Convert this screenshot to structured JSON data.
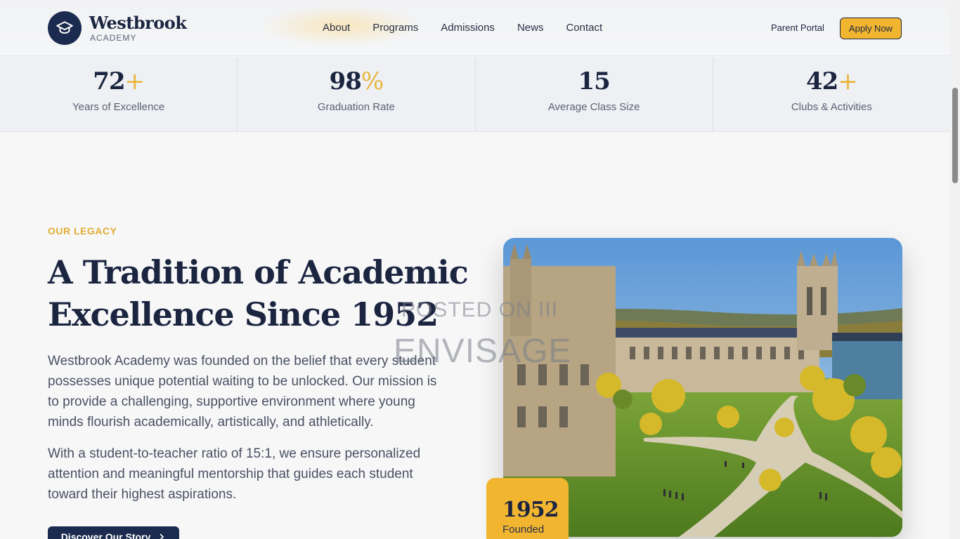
{
  "brand": {
    "name": "Westbrook",
    "sub": "ACADEMY"
  },
  "nav": {
    "items": [
      "About",
      "Programs",
      "Admissions",
      "News",
      "Contact"
    ],
    "parent_portal": "Parent Portal",
    "apply": "Apply Now"
  },
  "stats": [
    {
      "value": "72",
      "suffix": "+",
      "label": "Years of Excellence"
    },
    {
      "value": "98",
      "suffix": "%",
      "label": "Graduation Rate"
    },
    {
      "value": "15",
      "suffix": "",
      "label": "Average Class Size"
    },
    {
      "value": "42",
      "suffix": "+",
      "label": "Clubs & Activities"
    }
  ],
  "legacy": {
    "eyebrow": "OUR LEGACY",
    "title": "A Tradition of Academic Excellence Since 1952",
    "para1": "Westbrook Academy was founded on the belief that every student possesses unique potential waiting to be unlocked. Our mission is to provide a challenging, supportive environment where young minds flourish academically, artistically, and athletically.",
    "para2": "With a student-to-teacher ratio of 15:1, we ensure personalized attention and meaningful mentorship that guides each student toward their highest aspirations.",
    "button": "Discover Our Story",
    "founded_year": "1952",
    "founded_label": "Founded"
  },
  "watermark": {
    "line1": "POSTED ON III",
    "line2": "ENVISAGE"
  },
  "colors": {
    "navy": "#1b2a4f",
    "gold": "#f2b530",
    "accent_text": "#e2ad33"
  }
}
